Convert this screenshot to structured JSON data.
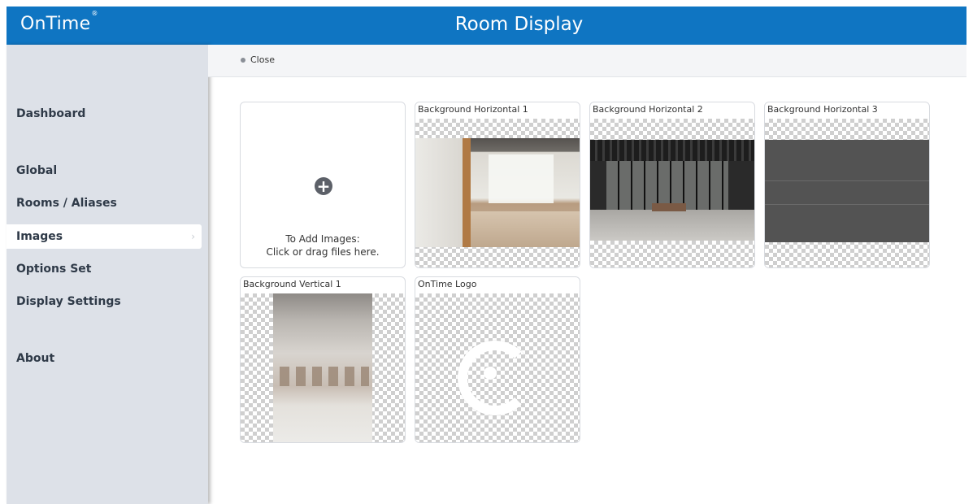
{
  "header": {
    "brand": "OnTime",
    "brand_mark": "®",
    "title": "Room Display"
  },
  "sidebar": {
    "items": [
      {
        "label": "Dashboard"
      },
      {
        "label": "Global"
      },
      {
        "label": "Rooms / Aliases"
      },
      {
        "label": "Images",
        "active": true
      },
      {
        "label": "Options Set"
      },
      {
        "label": "Display Settings"
      },
      {
        "label": "About"
      }
    ]
  },
  "topbar": {
    "close_label": "Close"
  },
  "images": {
    "add": {
      "line1": "To Add Images:",
      "line2": "Click or drag files here."
    },
    "cards": [
      {
        "title": "Background Horizontal 1"
      },
      {
        "title": "Background Horizontal 2"
      },
      {
        "title": "Background Horizontal 3"
      },
      {
        "title": "Background Vertical 1"
      },
      {
        "title": "OnTime Logo"
      }
    ]
  },
  "colors": {
    "header": "#0f75c2",
    "sidebar": "#dde1e8",
    "active_item": "#ffffff"
  }
}
